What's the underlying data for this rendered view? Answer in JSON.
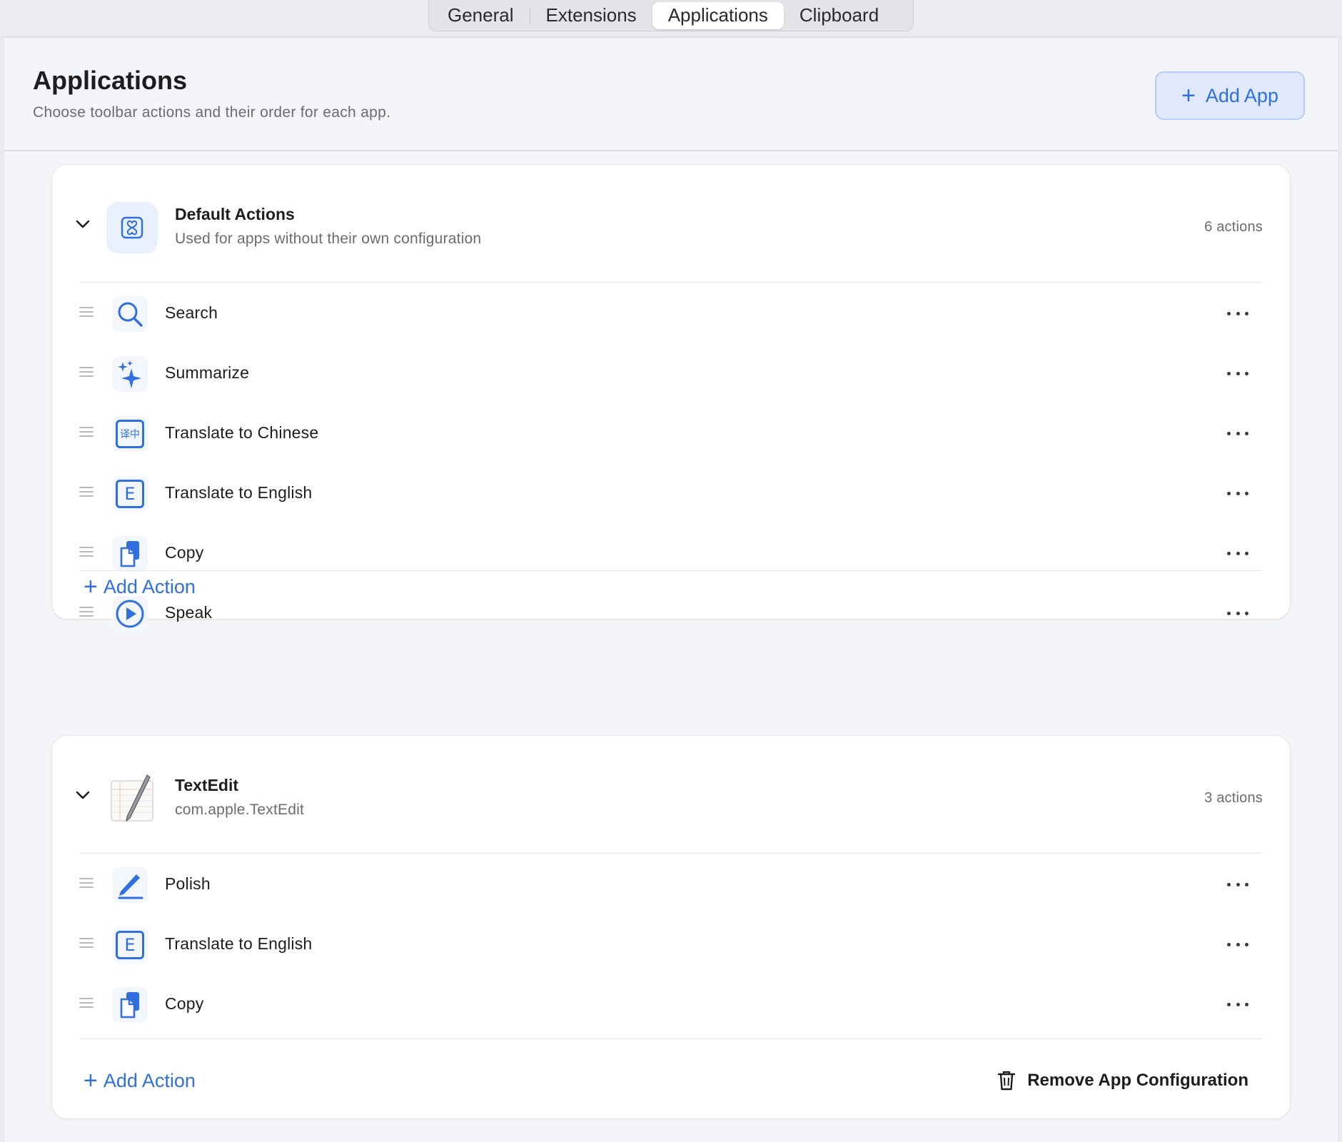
{
  "tabs": [
    {
      "label": "General",
      "active": false
    },
    {
      "label": "Extensions",
      "active": false
    },
    {
      "label": "Applications",
      "active": true
    },
    {
      "label": "Clipboard",
      "active": false
    }
  ],
  "header": {
    "title": "Applications",
    "subtitle": "Choose toolbar actions and their order for each app.",
    "add_app_label": "Add App"
  },
  "default_card": {
    "title": "Default Actions",
    "subtitle": "Used for apps without their own configuration",
    "count": "6 actions",
    "icon": "app-grid-icon",
    "actions": [
      {
        "label": "Search",
        "icon": "search-icon"
      },
      {
        "label": "Summarize",
        "icon": "sparkles-icon"
      },
      {
        "label": "Translate to Chinese",
        "icon": "translate-chinese-icon",
        "glyph": "译中"
      },
      {
        "label": "Translate to English",
        "icon": "translate-english-icon",
        "glyph": "E"
      },
      {
        "label": "Copy",
        "icon": "copy-icon"
      },
      {
        "label": "Speak",
        "icon": "play-circle-icon"
      }
    ],
    "add_action_label": "Add Action"
  },
  "textedit_card": {
    "title": "TextEdit",
    "subtitle": "com.apple.TextEdit",
    "count": "3 actions",
    "icon": "textedit-app-icon",
    "actions": [
      {
        "label": "Polish",
        "icon": "pencil-icon"
      },
      {
        "label": "Translate to English",
        "icon": "translate-english-icon",
        "glyph": "E"
      },
      {
        "label": "Copy",
        "icon": "copy-icon"
      }
    ],
    "add_action_label": "Add Action",
    "remove_label": "Remove App Configuration"
  },
  "colors": {
    "accent": "#2f6fe0",
    "accent_bg": "#dfe9fb",
    "background": "#f4f5f9",
    "card": "#ffffff"
  }
}
